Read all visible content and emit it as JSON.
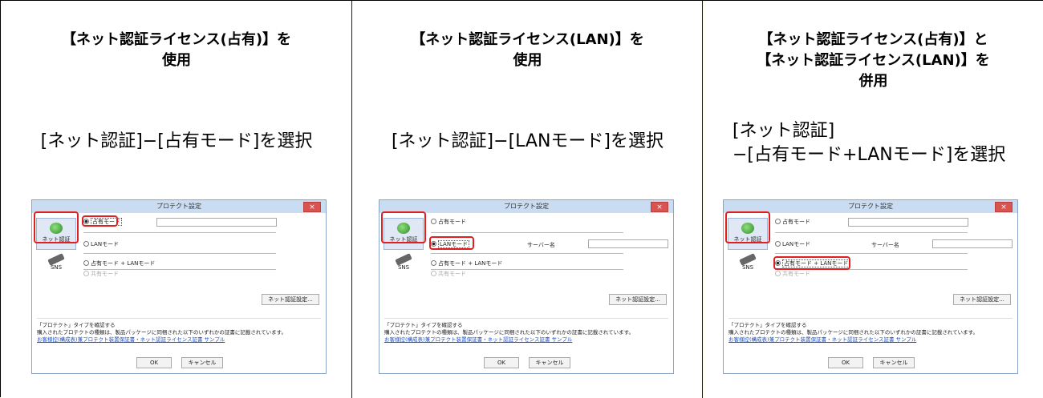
{
  "panels": [
    {
      "heading": [
        "【ネット認証ライセンス(占有)】を",
        "使用"
      ],
      "instruction": [
        "[ネット認証]−[占有モード]を選択"
      ],
      "selected": 0
    },
    {
      "heading": [
        "【ネット認証ライセンス(LAN)】を",
        "使用"
      ],
      "instruction": [
        "[ネット認証]−[LANモード]を選択"
      ],
      "selected": 1
    },
    {
      "heading": [
        "【ネット認証ライセンス(占有)】と",
        "【ネット認証ライセンス(LAN)】を",
        "併用"
      ],
      "instruction": [
        "[ネット認証]",
        "−[占有モード+LANモード]を選択"
      ],
      "selected": 2
    }
  ],
  "dialog": {
    "title": "プロテクト設定",
    "close": "×",
    "side_net": "ネット認証",
    "side_sns": "SNS",
    "options": [
      "占有モード",
      "LANモード",
      "占有モード + LANモード",
      "共有モード"
    ],
    "server_label": "サーバー名",
    "net_settings_button": "ネット認証設定...",
    "info_title": "「プロテクト」タイプを確認する",
    "info_text": "購入されたプロテクトの種類は、製品パッケージに同梱された以下のいずれかの証書に記載されています。",
    "info_link": "お客様控(構成表)兼プロテクト装置保証書・ネット認証ライセンス証書 サンプル",
    "ok": "OK",
    "cancel": "キャンセル"
  },
  "colors": {
    "background": "#fffde0",
    "highlight": "#e02020"
  }
}
